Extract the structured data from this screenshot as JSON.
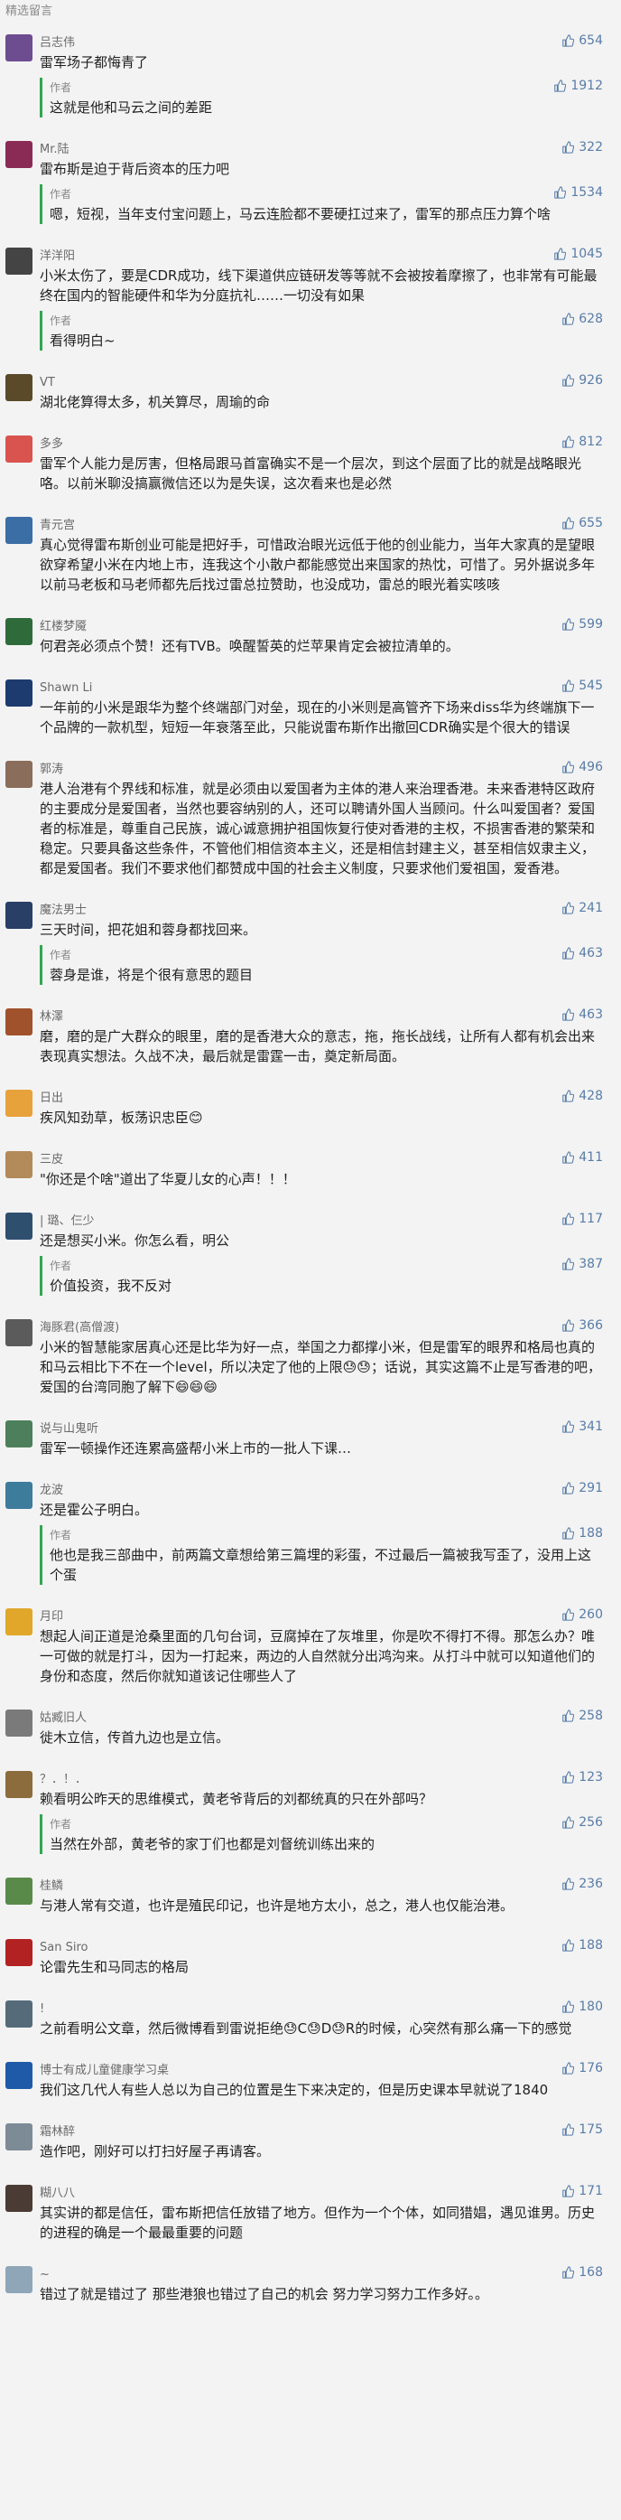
{
  "header": {
    "title": "精选留言"
  },
  "colors": {
    "like": "#587ca8",
    "author_bar": "#2fa84f"
  },
  "comments": [
    {
      "nickname": "吕志伟",
      "likes": "654",
      "text": "雷军场子都悔青了",
      "reply": {
        "author": "作者",
        "likes": "1912",
        "text": "这就是他和马云之间的差距"
      },
      "avatar_color": "#6d4c8f"
    },
    {
      "nickname": "Mr.陆",
      "likes": "322",
      "text": "雷布斯是迫于背后资本的压力吧",
      "reply": {
        "author": "作者",
        "likes": "1534",
        "text": "嗯，短视，当年支付宝问题上，马云连脸都不要硬扛过来了，雷军的那点压力算个啥"
      },
      "avatar_color": "#8a2b55"
    },
    {
      "nickname": "洋洋阳",
      "likes": "1045",
      "text": "小米太伤了，要是CDR成功，线下渠道供应链研发等等就不会被按着摩擦了，也非常有可能最终在国内的智能硬件和华为分庭抗礼……一切没有如果",
      "reply": {
        "author": "作者",
        "likes": "628",
        "text": "看得明白~"
      },
      "avatar_color": "#444444"
    },
    {
      "nickname": "VT",
      "likes": "926",
      "text": "湖北佬算得太多，机关算尽，周瑜的命",
      "avatar_color": "#5a4a2a"
    },
    {
      "nickname": "多多",
      "likes": "812",
      "text": "雷军个人能力是厉害，但格局跟马首富确实不是一个层次，到这个层面了比的就是战略眼光咯。以前米聊没搞赢微信还以为是失误，这次看来也是必然",
      "avatar_color": "#d9534f"
    },
    {
      "nickname": "青元宫",
      "likes": "655",
      "text": "真心觉得雷布斯创业可能是把好手，可惜政治眼光远低于他的创业能力，当年大家真的是望眼欲穿希望小米在内地上市，连我这个小散户都能感觉出来国家的热忱，可惜了。另外据说多年以前马老板和马老师都先后找过雷总拉赞助，也没成功，雷总的眼光着实咳咳",
      "avatar_color": "#3b6ea5"
    },
    {
      "nickname": "红楼梦魇",
      "likes": "599",
      "text": "何君尧必须点个赞！还有TVB。唤醒誓英的烂苹果肯定会被拉清单的。",
      "avatar_color": "#2f6b3a"
    },
    {
      "nickname": "Shawn Li",
      "likes": "545",
      "text": "一年前的小米是跟华为整个终端部门对垒，现在的小米则是高管齐下场来diss华为终端旗下一个品牌的一款机型，短短一年衰落至此，只能说雷布斯作出撤回CDR确实是个很大的错误",
      "avatar_color": "#1d3b6e"
    },
    {
      "nickname": "郭涛",
      "likes": "496",
      "text": "港人治港有个界线和标准，就是必须由以爱国者为主体的港人来治理香港。未来香港特区政府的主要成分是爱国者，当然也要容纳别的人，还可以聘请外国人当顾问。什么叫爱国者？爱国者的标准是，尊重自己民族，诚心诚意拥护祖国恢复行使对香港的主权，不损害香港的繁荣和稳定。只要具备这些条件，不管他们相信资本主义，还是相信封建主义，甚至相信奴隶主义，都是爱国者。我们不要求他们都赞成中国的社会主义制度，只要求他们爱祖国，爱香港。",
      "avatar_color": "#8a6d5a"
    },
    {
      "nickname": "魔法男士",
      "likes": "241",
      "text": "三天时间，把花姐和蓉身都找回来。",
      "reply": {
        "author": "作者",
        "likes": "463",
        "text": "蓉身是谁，将是个很有意思的题目"
      },
      "avatar_color": "#2a3f66"
    },
    {
      "nickname": "林澤",
      "likes": "463",
      "text": "磨，磨的是广大群众的眼里，磨的是香港大众的意志，拖，拖长战线，让所有人都有机会出来表现真实想法。久战不决，最后就是雷霆一击，奠定新局面。",
      "avatar_color": "#a0522d"
    },
    {
      "nickname": "日出",
      "likes": "428",
      "text": "疾风知劲草，板荡识忠臣😊",
      "avatar_color": "#e8a23b"
    },
    {
      "nickname": "三皮",
      "likes": "411",
      "text": "\"你还是个啥\"道出了华夏儿女的心声！！！",
      "avatar_color": "#b38a5a"
    },
    {
      "nickname": "| 璐、仨少",
      "likes": "117",
      "text": "还是想买小米。你怎么看，明公",
      "reply": {
        "author": "作者",
        "likes": "387",
        "text": "价值投资，我不反对"
      },
      "avatar_color": "#2f4f6f"
    },
    {
      "nickname": "海豚君(高僧渡)",
      "likes": "366",
      "text": "小米的智慧能家居真心还是比华为好一点，举国之力都撑小米，但是雷军的眼界和格局也真的和马云相比下不在一个level，所以决定了他的上限😓😓；话说，其实这篇不止是写香港的吧，爱国的台湾同胞了解下😄😄😄",
      "avatar_color": "#5b5b5b"
    },
    {
      "nickname": "说与山鬼听",
      "likes": "341",
      "text": "雷军一顿操作还连累高盛帮小米上市的一批人下课…",
      "avatar_color": "#4d7f5c"
    },
    {
      "nickname": "龙波",
      "likes": "291",
      "text": "还是霍公子明白。",
      "reply": {
        "author": "作者",
        "likes": "188",
        "text": "他也是我三部曲中，前两篇文章想给第三篇埋的彩蛋，不过最后一篇被我写歪了，没用上这个蛋"
      },
      "avatar_color": "#3e7c9c"
    },
    {
      "nickname": "月印",
      "likes": "260",
      "text": "想起人间正道是沧桑里面的几句台词，豆腐掉在了灰堆里，你是吹不得打不得。那怎么办？唯一可做的就是打斗，因为一打起来，两边的人自然就分出鸿沟来。从打斗中就可以知道他们的身份和态度，然后你就知道该记住哪些人了",
      "avatar_color": "#e0a72a"
    },
    {
      "nickname": "姑臧旧人",
      "likes": "258",
      "text": "徙木立信，传首九边也是立信。",
      "avatar_color": "#7a7a7a"
    },
    {
      "nickname": "？．！．",
      "likes": "123",
      "text": "赖看明公昨天的思维模式，黄老爷背后的刘都统真的只在外部吗？",
      "reply": {
        "author": "作者",
        "likes": "256",
        "text": "当然在外部，黄老爷的家丁们也都是刘督统训练出来的"
      },
      "avatar_color": "#8c6b3d"
    },
    {
      "nickname": "桂鳞",
      "likes": "236",
      "text": "与港人常有交道，也许是殖民印记，也许是地方太小，总之，港人也仅能治港。",
      "avatar_color": "#5a8a4a"
    },
    {
      "nickname": "San Siro",
      "likes": "188",
      "text": "论雷先生和马同志的格局",
      "avatar_color": "#b22222"
    },
    {
      "nickname": "!",
      "likes": "180",
      "text": "之前看明公文章，然后微博看到雷说拒绝😓C😓D😓R的时候，心突然有那么痛一下的感觉",
      "avatar_color": "#556b7a"
    },
    {
      "nickname": "博士有成儿童健康学习桌",
      "likes": "176",
      "text": "我们这几代人有些人总以为自己的位置是生下来决定的，但是历史课本早就说了1840",
      "avatar_color": "#1e5aa8"
    },
    {
      "nickname": "霜林醉",
      "likes": "175",
      "text": "造作吧，刚好可以打扫好屋子再请客。",
      "avatar_color": "#7d8b97"
    },
    {
      "nickname": "糊八八",
      "likes": "171",
      "text": "其实讲的都是信任，雷布斯把信任放错了地方。但作为一个个体，如同猎娼，遇见谁男。历史的进程的确是一个最最重要的问题",
      "avatar_color": "#4a3b35"
    },
    {
      "nickname": "~",
      "likes": "168",
      "text": "错过了就是错过了 那些港狼也错过了自己的机会 努力学习努力工作多好。。",
      "avatar_color": "#8fa6b8"
    }
  ]
}
